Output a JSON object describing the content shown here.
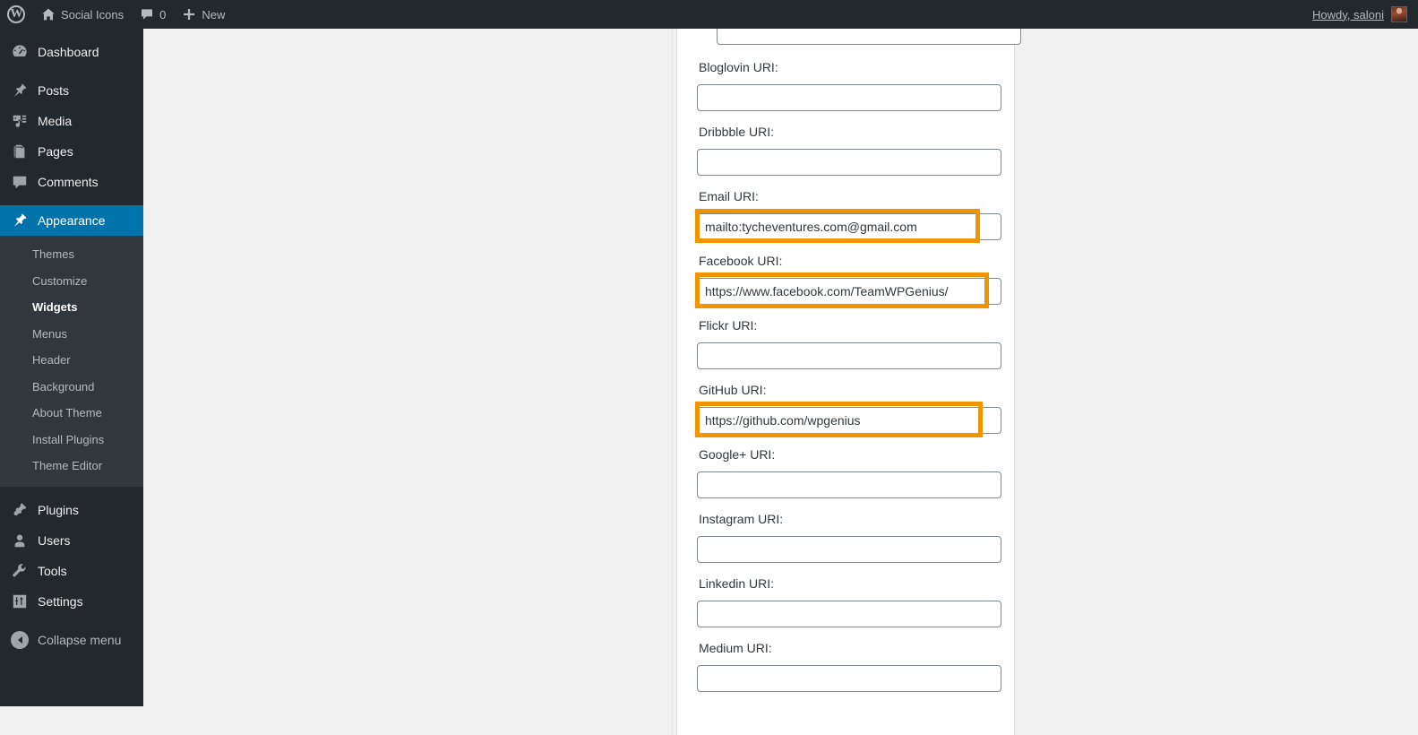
{
  "adminbar": {
    "logo_glyph": "W",
    "site_name": "Social Icons",
    "comment_count": "0",
    "new_label": "New",
    "howdy": "Howdy, saloni"
  },
  "sidebar": {
    "items": [
      {
        "label": "Dashboard",
        "icon": "dashboard-icon",
        "current": false
      },
      {
        "label": "Posts",
        "icon": "pin-icon",
        "current": false
      },
      {
        "label": "Media",
        "icon": "media-icon",
        "current": false
      },
      {
        "label": "Pages",
        "icon": "pages-icon",
        "current": false
      },
      {
        "label": "Comments",
        "icon": "comment-icon",
        "current": false
      },
      {
        "label": "Appearance",
        "icon": "brush-icon",
        "current": true
      },
      {
        "label": "Plugins",
        "icon": "plug-icon",
        "current": false
      },
      {
        "label": "Users",
        "icon": "user-icon",
        "current": false
      },
      {
        "label": "Tools",
        "icon": "wrench-icon",
        "current": false
      },
      {
        "label": "Settings",
        "icon": "settings-icon",
        "current": false
      }
    ],
    "appearance_submenu": [
      {
        "label": "Themes",
        "current": false
      },
      {
        "label": "Customize",
        "current": false
      },
      {
        "label": "Widgets",
        "current": true
      },
      {
        "label": "Menus",
        "current": false
      },
      {
        "label": "Header",
        "current": false
      },
      {
        "label": "Background",
        "current": false
      },
      {
        "label": "About Theme",
        "current": false
      },
      {
        "label": "Install Plugins",
        "current": false
      },
      {
        "label": "Theme Editor",
        "current": false
      }
    ],
    "collapse_label": "Collapse menu"
  },
  "panel": {
    "fields": [
      {
        "label": "",
        "value": "",
        "clipped": true,
        "highlighted": false
      },
      {
        "label": "Bloglovin URI:",
        "value": "",
        "clipped": false,
        "highlighted": false
      },
      {
        "label": "Dribbble URI:",
        "value": "",
        "clipped": false,
        "highlighted": false
      },
      {
        "label": "Email URI:",
        "value": "mailto:tycheventures.com@gmail.com",
        "clipped": false,
        "highlighted": true
      },
      {
        "label": "Facebook URI:",
        "value": "https://www.facebook.com/TeamWPGenius/",
        "clipped": false,
        "highlighted": true
      },
      {
        "label": "Flickr URI:",
        "value": "",
        "clipped": false,
        "highlighted": false
      },
      {
        "label": "GitHub URI:",
        "value": "https://github.com/wpgenius",
        "clipped": false,
        "highlighted": true
      },
      {
        "label": "Google+ URI:",
        "value": "",
        "clipped": false,
        "highlighted": false
      },
      {
        "label": "Instagram URI:",
        "value": "",
        "clipped": false,
        "highlighted": false
      },
      {
        "label": "Linkedin URI:",
        "value": "",
        "clipped": false,
        "highlighted": false
      },
      {
        "label": "Medium URI:",
        "value": "",
        "clipped": false,
        "highlighted": false
      }
    ]
  },
  "colors": {
    "admin_bar": "#23282d",
    "sidebar": "#23282d",
    "submenu": "#32373c",
    "current_menu": "#0073aa",
    "annotation": "#f29400",
    "workspace": "#f1f1f1"
  }
}
